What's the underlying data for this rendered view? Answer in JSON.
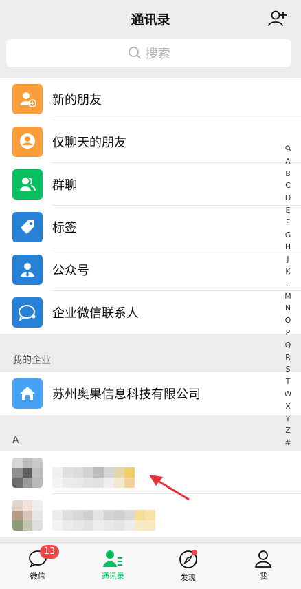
{
  "header": {
    "title": "通讯录"
  },
  "search": {
    "placeholder": "搜索"
  },
  "entries": [
    {
      "label": "新的朋友",
      "icon": "new-friend-icon",
      "color": "#fa9d3b"
    },
    {
      "label": "仅聊天的朋友",
      "icon": "chat-only-friend-icon",
      "color": "#fa9d3b"
    },
    {
      "label": "群聊",
      "icon": "group-chat-icon",
      "color": "#07c160"
    },
    {
      "label": "标签",
      "icon": "tag-icon",
      "color": "#2782d7"
    },
    {
      "label": "公众号",
      "icon": "official-account-icon",
      "color": "#2782d7"
    },
    {
      "label": "企业微信联系人",
      "icon": "wecom-contact-icon",
      "color": "#2782d7"
    }
  ],
  "enterprise": {
    "section_title": "我的企业",
    "name": "苏州奥果信息科技有限公司",
    "icon": "home-icon",
    "color": "#45a2f5"
  },
  "contacts_section": {
    "letter": "A"
  },
  "index_letters": [
    "A",
    "B",
    "C",
    "D",
    "E",
    "F",
    "G",
    "H",
    "J",
    "K",
    "L",
    "M",
    "N",
    "O",
    "P",
    "Q",
    "R",
    "S",
    "T",
    "W",
    "X",
    "Y",
    "Z",
    "#"
  ],
  "tabbar": {
    "tabs": [
      {
        "label": "微信",
        "icon": "chat-bubble-icon",
        "badge": "13"
      },
      {
        "label": "通讯录",
        "icon": "contacts-icon",
        "active": true
      },
      {
        "label": "发现",
        "icon": "compass-icon"
      },
      {
        "label": "我",
        "icon": "profile-icon"
      }
    ]
  },
  "colors": {
    "accent": "#07c160",
    "badge": "#f04848",
    "arrow": "#e5303a"
  }
}
